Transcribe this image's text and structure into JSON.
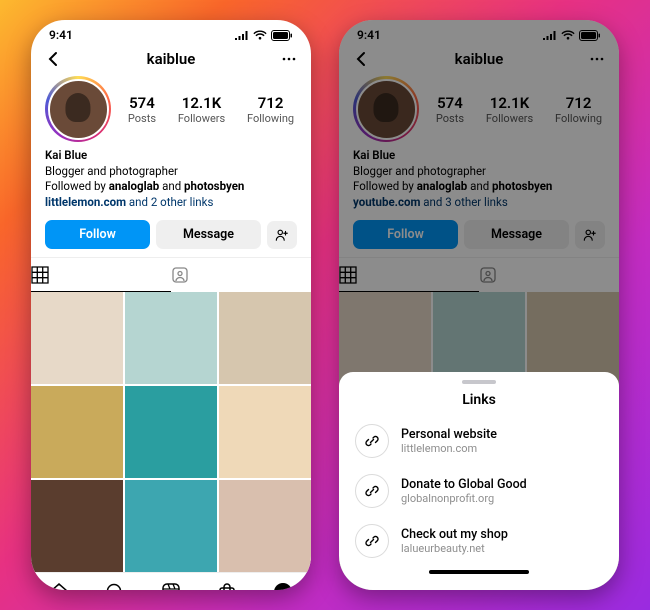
{
  "status": {
    "time": "9:41"
  },
  "profile": {
    "username": "kaiblue",
    "stats": {
      "posts_num": "574",
      "posts_label": "Posts",
      "followers_num": "12.1K",
      "followers_label": "Followers",
      "following_num": "712",
      "following_label": "Following"
    },
    "name": "Kai Blue",
    "desc": "Blogger and photographer",
    "followed_prefix": "Followed by ",
    "followed_1": "analoglab",
    "followed_and": " and ",
    "followed_2": "photosbyen"
  },
  "links_summary_left": {
    "domain": "littlelemon.com",
    "rest": " and 2 other links"
  },
  "links_summary_right": {
    "domain": "youtube.com",
    "rest": " and 3 other links"
  },
  "buttons": {
    "follow": "Follow",
    "message": "Message"
  },
  "sheet": {
    "title": "Links",
    "items": [
      {
        "title": "Personal website",
        "url": "littlelemon.com"
      },
      {
        "title": "Donate to Global Good",
        "url": "globalnonprofit.org"
      },
      {
        "title": "Check out my shop",
        "url": "lalueurbeauty.net"
      }
    ]
  },
  "tiles": [
    "#e7d9c8",
    "#b5d5d1",
    "#d6c6ae",
    "#c9aa5b",
    "#2a9ea0",
    "#efd9b8",
    "#5a3d2e",
    "#3da6b0",
    "#d9bfae"
  ]
}
